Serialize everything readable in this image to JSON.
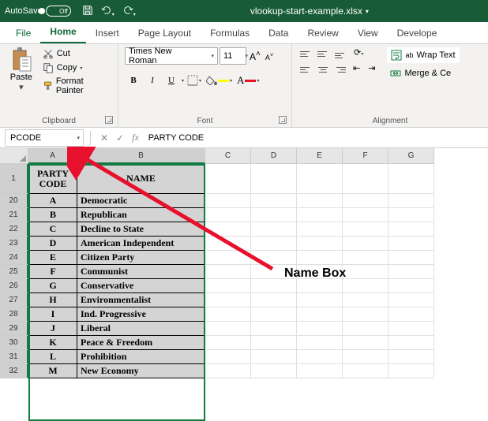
{
  "titlebar": {
    "autosave": "AutoSave",
    "autosave_state": "Off",
    "filename": "vlookup-start-example.xlsx"
  },
  "tabs": [
    "File",
    "Home",
    "Insert",
    "Page Layout",
    "Formulas",
    "Data",
    "Review",
    "View",
    "Develope"
  ],
  "active_tab": "Home",
  "ribbon": {
    "clipboard": {
      "label": "Clipboard",
      "paste": "Paste",
      "cut": "Cut",
      "copy": "Copy",
      "format_painter": "Format Painter"
    },
    "font": {
      "label": "Font",
      "name": "Times New Roman",
      "size": "11",
      "bold": "B",
      "italic": "I",
      "underline": "U"
    },
    "alignment": {
      "label": "Alignment",
      "wrap": "Wrap Text",
      "merge": "Merge & Ce"
    }
  },
  "formula_bar": {
    "namebox": "PCODE",
    "value": "PARTY CODE"
  },
  "columns": [
    "A",
    "B",
    "C",
    "D",
    "E",
    "F",
    "G"
  ],
  "header_row": "1",
  "data_rows": [
    "20",
    "21",
    "22",
    "23",
    "24",
    "25",
    "26",
    "27",
    "28",
    "29",
    "30",
    "31",
    "32"
  ],
  "table": {
    "h1": "PARTY CODE",
    "h2": "NAME",
    "codes": [
      "A",
      "B",
      "C",
      "D",
      "E",
      "F",
      "G",
      "H",
      "I",
      "J",
      "K",
      "L",
      "M"
    ],
    "names": [
      "Democratic",
      "Republican",
      "Decline to State",
      "American Independent",
      "Citizen Party",
      "Communist",
      "Conservative",
      "Environmentalist",
      "Ind. Progressive",
      "Liberal",
      "Peace & Freedom",
      "Prohibition",
      "New Economy"
    ]
  },
  "annotation": {
    "label": "Name Box"
  }
}
